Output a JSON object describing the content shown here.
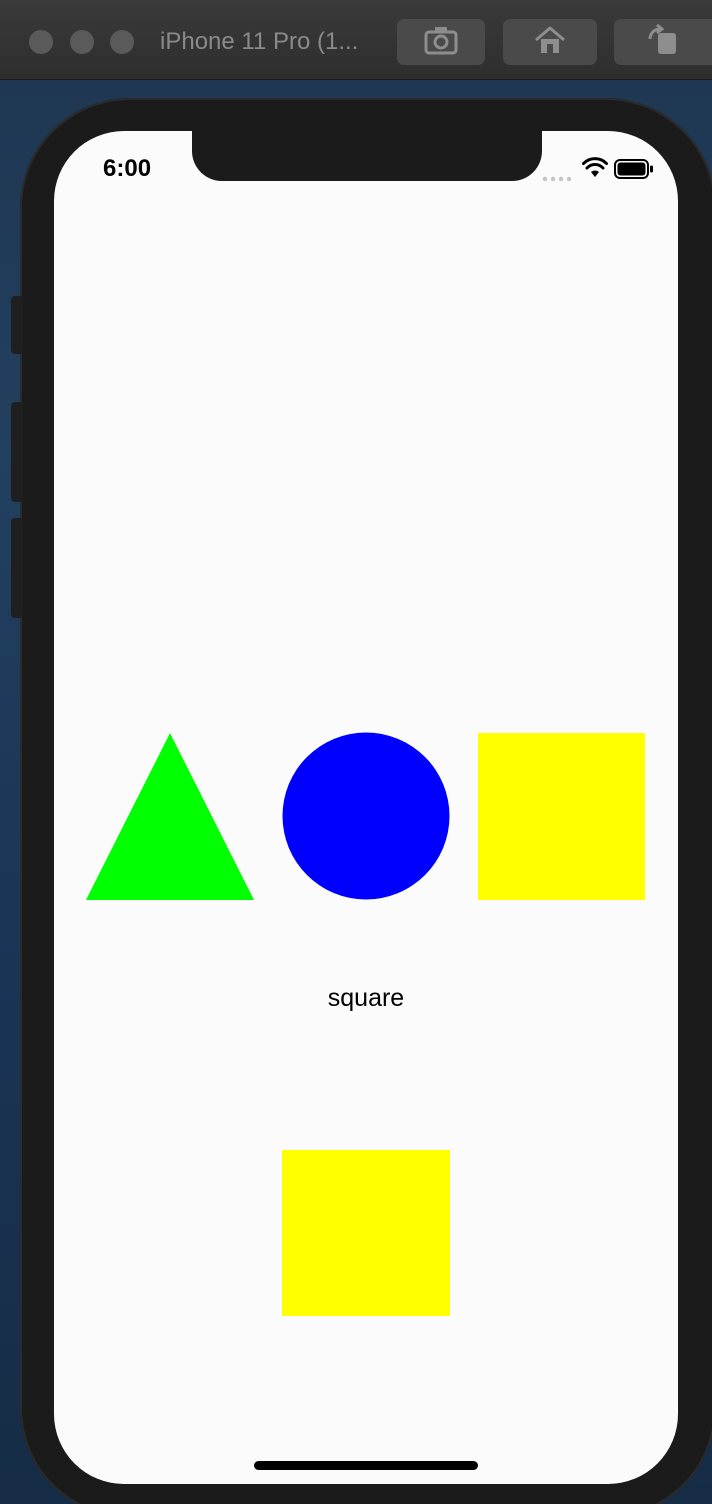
{
  "window": {
    "title": "iPhone 11 Pro (1..."
  },
  "toolbar": {
    "screenshot_icon": "camera-icon",
    "home_icon": "home-icon",
    "rotate_icon": "rotate-icon"
  },
  "status_bar": {
    "time": "6:00",
    "signal_icon": "signal-icon",
    "wifi_icon": "wifi-icon",
    "battery_icon": "battery-icon"
  },
  "shapes": {
    "options": [
      {
        "name": "triangle",
        "color": "#00ff00"
      },
      {
        "name": "circle",
        "color": "#0000ff"
      },
      {
        "name": "square",
        "color": "#ffff00"
      }
    ],
    "selected_label": "square",
    "selected_color": "#ffff00"
  }
}
